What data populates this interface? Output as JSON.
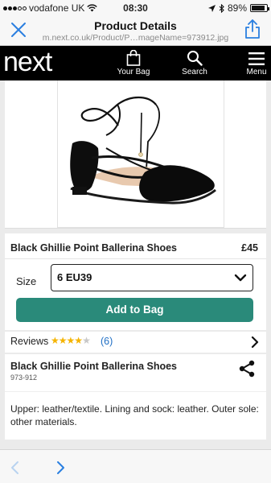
{
  "status_bar": {
    "carrier": "vodafone UK",
    "time": "08:30",
    "battery_text": "89%",
    "battery_level": 0.89
  },
  "browser": {
    "title": "Product Details",
    "url": "m.next.co.uk/Product/P…mageName=973912.jpg",
    "close_icon": "close-icon",
    "share_icon": "share-icon"
  },
  "header": {
    "logo": "next",
    "bag_label": "Your Bag",
    "search_label": "Search",
    "menu_label": "Menu"
  },
  "product": {
    "name": "Black Ghillie Point Ballerina Shoes",
    "price": "£45",
    "size_label": "Size",
    "size_value": "6 EU39",
    "add_to_bag_label": "Add to Bag",
    "accent_color": "#2a8a7a"
  },
  "reviews": {
    "label": "Reviews",
    "rating_stars": 4,
    "rating_max": 5,
    "count": "(6)"
  },
  "details": {
    "name": "Black Ghillie Point Ballerina Shoes",
    "code": "973-912",
    "description": "Upper: leather/textile. Lining and sock: leather. Outer sole: other materials."
  }
}
